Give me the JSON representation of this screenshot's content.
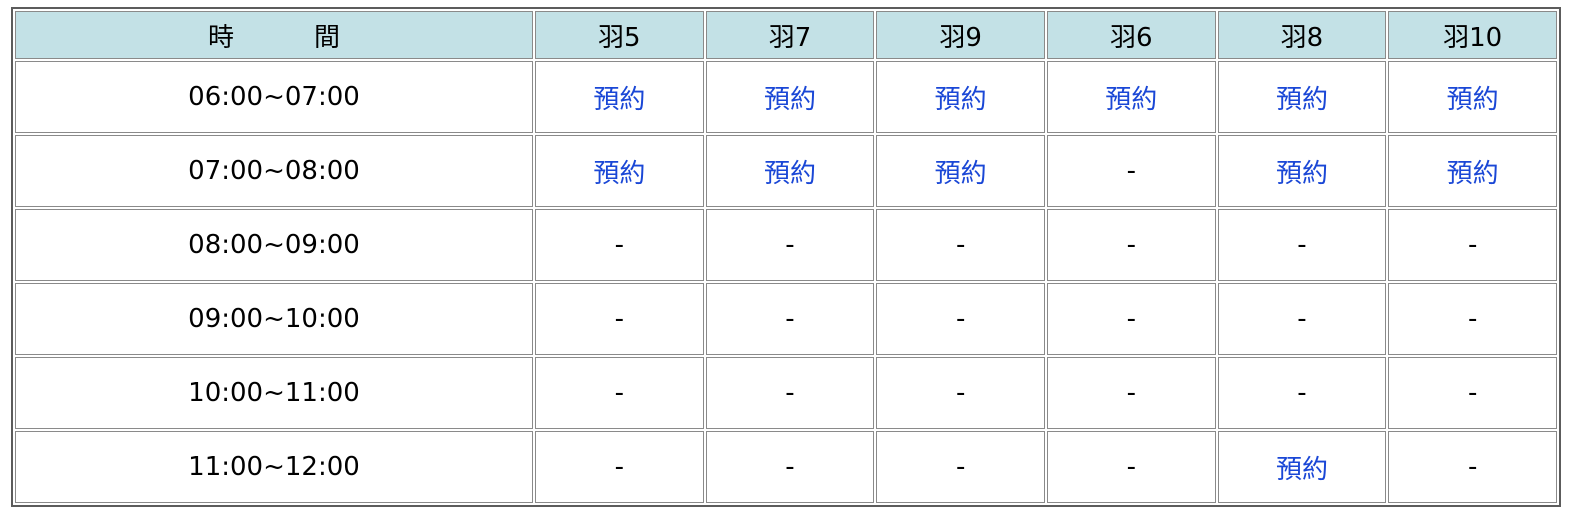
{
  "header": {
    "time_label_1": "時",
    "time_label_2": "間",
    "courts": [
      "羽5",
      "羽7",
      "羽9",
      "羽6",
      "羽8",
      "羽10"
    ]
  },
  "rows": [
    {
      "time": "06:00~07:00",
      "cells": [
        "預約",
        "預約",
        "預約",
        "預約",
        "預約",
        "預約"
      ]
    },
    {
      "time": "07:00~08:00",
      "cells": [
        "預約",
        "預約",
        "預約",
        "-",
        "預約",
        "預約"
      ]
    },
    {
      "time": "08:00~09:00",
      "cells": [
        "-",
        "-",
        "-",
        "-",
        "-",
        "-"
      ]
    },
    {
      "time": "09:00~10:00",
      "cells": [
        "-",
        "-",
        "-",
        "-",
        "-",
        "-"
      ]
    },
    {
      "time": "10:00~11:00",
      "cells": [
        "-",
        "-",
        "-",
        "-",
        "-",
        "-"
      ]
    },
    {
      "time": "11:00~12:00",
      "cells": [
        "-",
        "-",
        "-",
        "-",
        "預約",
        "-"
      ]
    }
  ],
  "colors": {
    "header_bg": "#c3e1e6",
    "link": "#1a47d6",
    "border": "#8a8a8a"
  }
}
